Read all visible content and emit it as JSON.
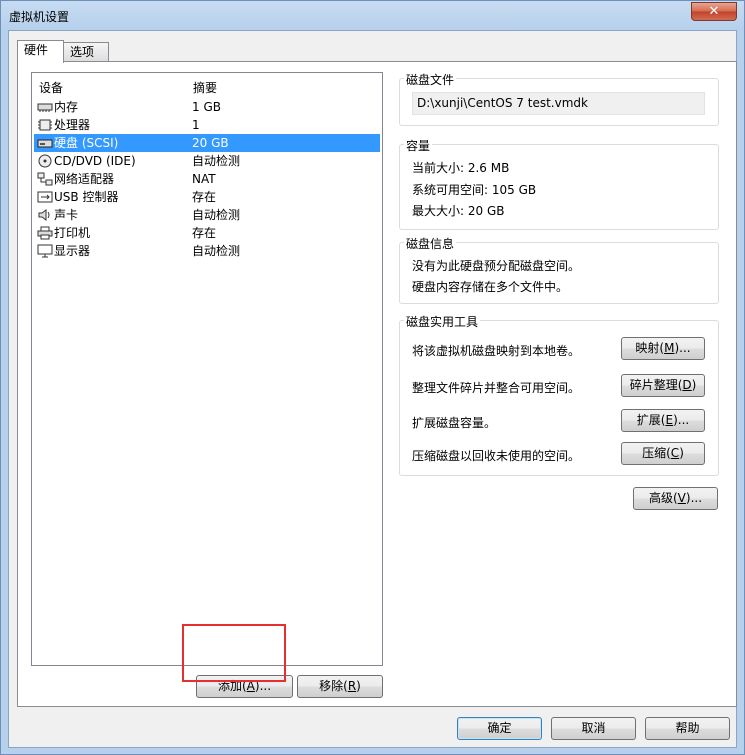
{
  "window": {
    "title": "虚拟机设置",
    "close_label": "✕"
  },
  "tabs": [
    {
      "label": "硬件"
    },
    {
      "label": "选项"
    }
  ],
  "device_list": {
    "col_device": "设备",
    "col_summary": "摘要",
    "rows": [
      {
        "name": "内存",
        "summary": "1 GB",
        "icon": "memory-icon"
      },
      {
        "name": "处理器",
        "summary": "1",
        "icon": "processor-icon"
      },
      {
        "name": "硬盘 (SCSI)",
        "summary": "20 GB",
        "icon": "hard-disk-icon",
        "selected": true
      },
      {
        "name": "CD/DVD (IDE)",
        "summary": "自动检测",
        "icon": "cd-dvd-icon"
      },
      {
        "name": "网络适配器",
        "summary": "NAT",
        "icon": "network-adapter-icon"
      },
      {
        "name": "USB 控制器",
        "summary": "存在",
        "icon": "usb-icon"
      },
      {
        "name": "声卡",
        "summary": "自动检测",
        "icon": "sound-card-icon"
      },
      {
        "name": "打印机",
        "summary": "存在",
        "icon": "printer-icon"
      },
      {
        "name": "显示器",
        "summary": "自动检测",
        "icon": "display-icon"
      }
    ]
  },
  "buttons": {
    "add_pre": "添加(",
    "add_key": "A",
    "add_post": ")...",
    "remove_pre": "移除(",
    "remove_key": "R",
    "remove_post": ")",
    "ok": "确定",
    "cancel": "取消",
    "help": "帮助",
    "advanced_pre": "高级(",
    "advanced_key": "V",
    "advanced_post": ")..."
  },
  "disk_file": {
    "title": "磁盘文件",
    "path": "D:\\xunji\\CentOS 7 test.vmdk"
  },
  "capacity": {
    "title": "容量",
    "current": "当前大小: 2.6 MB",
    "available": "系统可用空间: 105 GB",
    "max": "最大大小: 20 GB"
  },
  "disk_info": {
    "title": "磁盘信息",
    "line1": "没有为此硬盘预分配磁盘空间。",
    "line2": "硬盘内容存储在多个文件中。"
  },
  "utilities": {
    "title": "磁盘实用工具",
    "map_desc": "将该虚拟机磁盘映射到本地卷。",
    "map_pre": "映射(",
    "map_key": "M",
    "map_post": ")...",
    "defrag_desc": "整理文件碎片并整合可用空间。",
    "defrag_pre": "碎片整理(",
    "defrag_key": "D",
    "defrag_post": ")",
    "expand_desc": "扩展磁盘容量。",
    "expand_pre": "扩展(",
    "expand_key": "E",
    "expand_post": ")...",
    "compact_desc": "压缩磁盘以回收未使用的空间。",
    "compact_pre": "压缩(",
    "compact_key": "C",
    "compact_post": ")"
  }
}
